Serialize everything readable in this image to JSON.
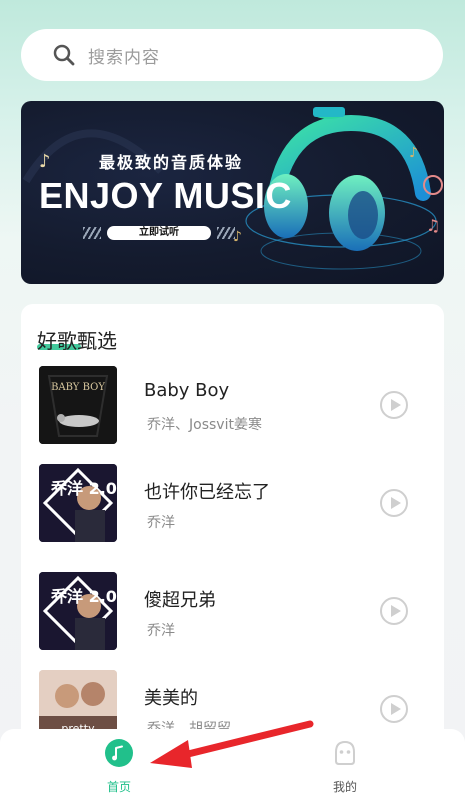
{
  "search": {
    "placeholder": "搜索内容"
  },
  "banner": {
    "subtitle": "最极致的音质体验",
    "title": "ENJOY MUSIC",
    "cta": "立即试听"
  },
  "section": {
    "title": "好歌甄选"
  },
  "songs": [
    {
      "title": "Baby Boy",
      "artist": "乔洋、Jossvit姜寒",
      "cover_text": "BABY BOY"
    },
    {
      "title": "也许你已经忘了",
      "artist": "乔洋",
      "cover_text": "乔洋 2.0"
    },
    {
      "title": "傻超兄弟",
      "artist": "乔洋",
      "cover_text": "乔洋 2.0"
    },
    {
      "title": "美美的",
      "artist": "乔洋、胡留留",
      "cover_text": "pretty"
    }
  ],
  "tabbar": {
    "home_label": "首页",
    "mine_label": "我的"
  },
  "colors": {
    "accent": "#21c08b",
    "arrow": "#e8262b"
  }
}
